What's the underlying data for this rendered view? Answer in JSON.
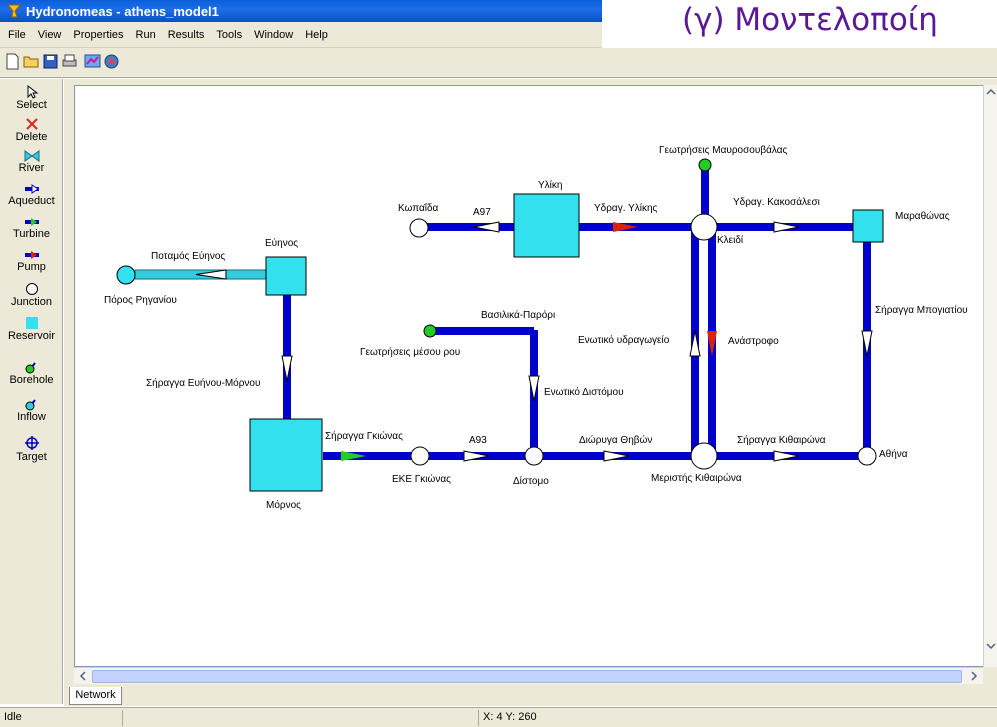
{
  "window": {
    "title": "Hydronomeas - athens_model1"
  },
  "slide_heading": "(γ) Μοντελοποίη",
  "menu": [
    "File",
    "View",
    "Properties",
    "Run",
    "Results",
    "Tools",
    "Window",
    "Help"
  ],
  "toolbar": {
    "buttons": [
      {
        "name": "new-file-icon"
      },
      {
        "name": "open-folder-icon"
      },
      {
        "name": "save-icon"
      },
      {
        "name": "print-icon"
      },
      {
        "name": "chart-icon"
      },
      {
        "name": "brain-icon"
      }
    ]
  },
  "palette": {
    "tools": [
      {
        "label": "Select"
      },
      {
        "label": "Delete"
      },
      {
        "label": "River"
      },
      {
        "label": "Aqueduct"
      },
      {
        "label": "Turbine"
      },
      {
        "label": "Pump"
      },
      {
        "label": "Junction"
      },
      {
        "label": "Reservoir"
      },
      {
        "label": "Borehole"
      },
      {
        "label": "Inflow"
      },
      {
        "label": "Target"
      }
    ]
  },
  "network": {
    "labels": {
      "evinos": "Εύηνος",
      "potamos_evinos": "Ποταμός Εύηνος",
      "poros_riganiou": "Πόρος Ρηγανίου",
      "siragga_evinou_mornou": "Σήραγγα Ευήνου-Μόρνου",
      "mornos": "Μόρνος",
      "siragga_gkionas": "Σήραγγα Γκιώνας",
      "eke_gkionas": "ΕΚΕ Γκιώνας",
      "a93": "Α93",
      "distomo": "Δίστομο",
      "enotiko_distomou": "Ενωτικό Διστόμου",
      "vasilika_parori": "Βασιλικά-Παρόρι",
      "geotriseis_mesou_rou": "Γεωτρήσεις μέσου ρου",
      "diorygha_thivon": "Διώρυγα Θηβών",
      "meristis_kithairona": "Μεριστής Κιθαιρώνα",
      "siragga_kithairona": "Σήραγγα Κιθαιρώνα",
      "athina": "Αθήνα",
      "siragga_mpogiatiou": "Σήραγγα Μπογιατίου",
      "marathonas": "Μαραθώνας",
      "ydrag_kakosalesi": "Υδραγ. Κακοσάλεσι",
      "kleidi": "Κλειδί",
      "geotriseis_mavrosouvalas": "Γεωτρήσεις Μαυροσουβάλας",
      "yliki": "Υλίκη",
      "ydrag_ylikis": "Υδραγ. Υλίκης",
      "kopaida": "Κωπαΐδα",
      "a97": "Α97",
      "enotiko_ydragogeio": "Ενωτικό υδραγωγείο",
      "anastrofo": "Ανάστροφο"
    },
    "colors": {
      "aqueduct": "#0000cc",
      "river": "#33ccdd",
      "reservoir": "#33e0ee",
      "borehole": "#22cc22",
      "turbine": "#22cc22",
      "pump": "#dd2200"
    }
  },
  "tabs": {
    "network": "Network"
  },
  "status": {
    "state": "Idle",
    "coords": "X: 4 Y: 260"
  }
}
